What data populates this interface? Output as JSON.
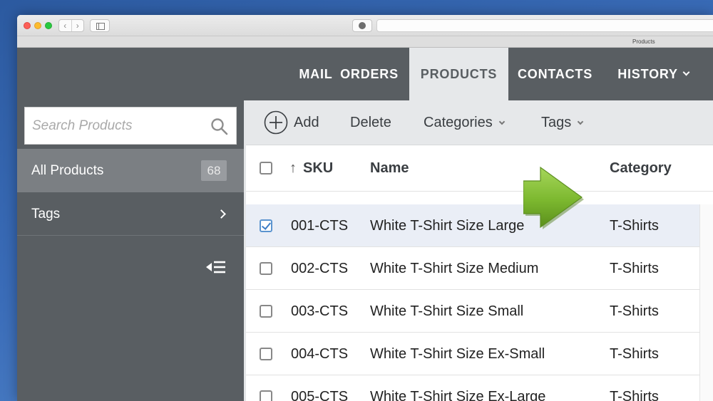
{
  "browser": {
    "tab_title": "Products"
  },
  "nav": {
    "items": [
      {
        "label": "MAIL"
      },
      {
        "label": "ORDERS"
      },
      {
        "label": "PRODUCTS"
      },
      {
        "label": "CONTACTS"
      },
      {
        "label": "HISTORY"
      }
    ],
    "active": "PRODUCTS"
  },
  "sidebar": {
    "search_placeholder": "Search Products",
    "all_products_label": "All Products",
    "all_products_count": "68",
    "tags_label": "Tags"
  },
  "toolbar": {
    "add_label": "Add",
    "delete_label": "Delete",
    "categories_label": "Categories",
    "tags_label": "Tags"
  },
  "table": {
    "columns": [
      "SKU",
      "Name",
      "Category"
    ],
    "sort_column": "SKU",
    "rows": [
      {
        "sku": "001-CTS",
        "name": "White T-Shirt Size Large",
        "category": "T-Shirts",
        "checked": true
      },
      {
        "sku": "002-CTS",
        "name": "White T-Shirt Size Medium",
        "category": "T-Shirts",
        "checked": false
      },
      {
        "sku": "003-CTS",
        "name": "White T-Shirt Size Small",
        "category": "T-Shirts",
        "checked": false
      },
      {
        "sku": "004-CTS",
        "name": "White T-Shirt Size Ex-Small",
        "category": "T-Shirts",
        "checked": false
      },
      {
        "sku": "005-CTS",
        "name": "White T-Shirt Size Ex-Large",
        "category": "T-Shirts",
        "checked": false
      }
    ]
  },
  "colors": {
    "header_bg": "#595e62",
    "active_tab_bg": "#e6e8ea",
    "selected_row_bg": "#eaeef6",
    "arrow_green": "#7cb82f"
  }
}
